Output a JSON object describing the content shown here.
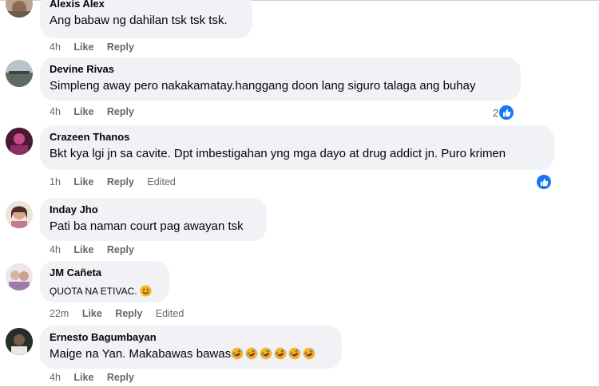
{
  "comments": [
    {
      "name": "Alexis Alex",
      "text": "Ang babaw ng dahilan tsk tsk tsk.",
      "time": "4h",
      "like": "Like",
      "reply": "Reply"
    },
    {
      "name": "Devine Rivas",
      "text": "Simpleng away pero nakakamatay.hanggang doon lang siguro talaga ang buhay",
      "time": "4h",
      "like": "Like",
      "reply": "Reply",
      "reaction_count": "2"
    },
    {
      "name": "Crazeen Thanos",
      "text": "Bkt kya lgi jn sa cavite. Dpt imbestigahan yng mga dayo at drug addict jn. Puro krimen",
      "time": "1h",
      "like": "Like",
      "reply": "Reply",
      "edited": "Edited"
    },
    {
      "name": "Inday Jho",
      "text": "Pati ba naman court pag awayan tsk",
      "time": "4h",
      "like": "Like",
      "reply": "Reply"
    },
    {
      "name": "JM Cañeta",
      "text": "ϘUOTA NA ETIVAC.",
      "time": "22m",
      "like": "Like",
      "reply": "Reply",
      "edited": "Edited"
    },
    {
      "name": "Ernesto Bagumbayan",
      "text": "Maige na Yan. Makabawas bawas",
      "time": "4h",
      "like": "Like",
      "reply": "Reply"
    }
  ],
  "colors": {
    "bubble": "#f0f2f5",
    "meta": "#65676b",
    "like_badge": "#1877f2",
    "emoji": "#f7b125"
  },
  "icons": {
    "like_reaction": "thumbs-up-icon",
    "smile_emoji": "smiling-face-emoji",
    "laugh_emoji": "rolling-laughing-emoji"
  }
}
